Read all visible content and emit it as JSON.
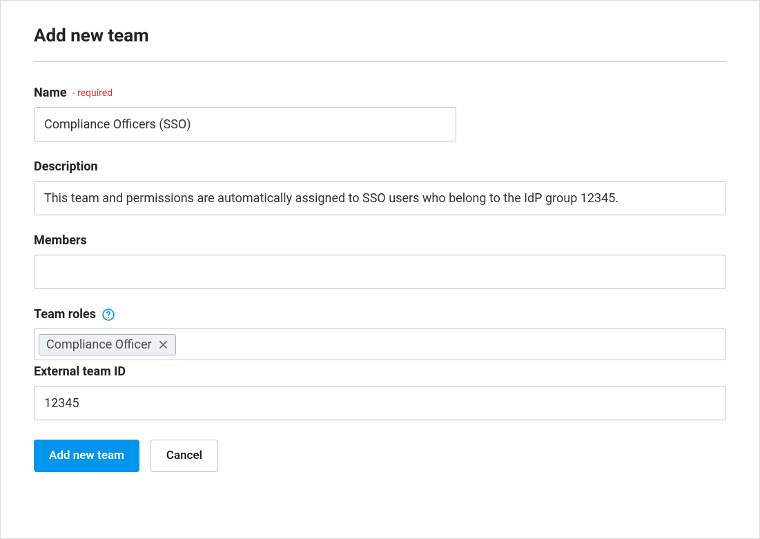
{
  "header": {
    "title": "Add new team"
  },
  "form": {
    "name": {
      "label": "Name",
      "required_text": "- required",
      "value": "Compliance Officers (SSO)"
    },
    "description": {
      "label": "Description",
      "value": "This team and permissions are automatically assigned to SSO users who belong to the IdP group 12345."
    },
    "members": {
      "label": "Members",
      "value": ""
    },
    "team_roles": {
      "label": "Team roles",
      "chips": [
        {
          "label": "Compliance Officer"
        }
      ]
    },
    "external_team_id": {
      "label": "External team ID",
      "value": "12345"
    }
  },
  "buttons": {
    "submit": "Add new team",
    "cancel": "Cancel"
  }
}
